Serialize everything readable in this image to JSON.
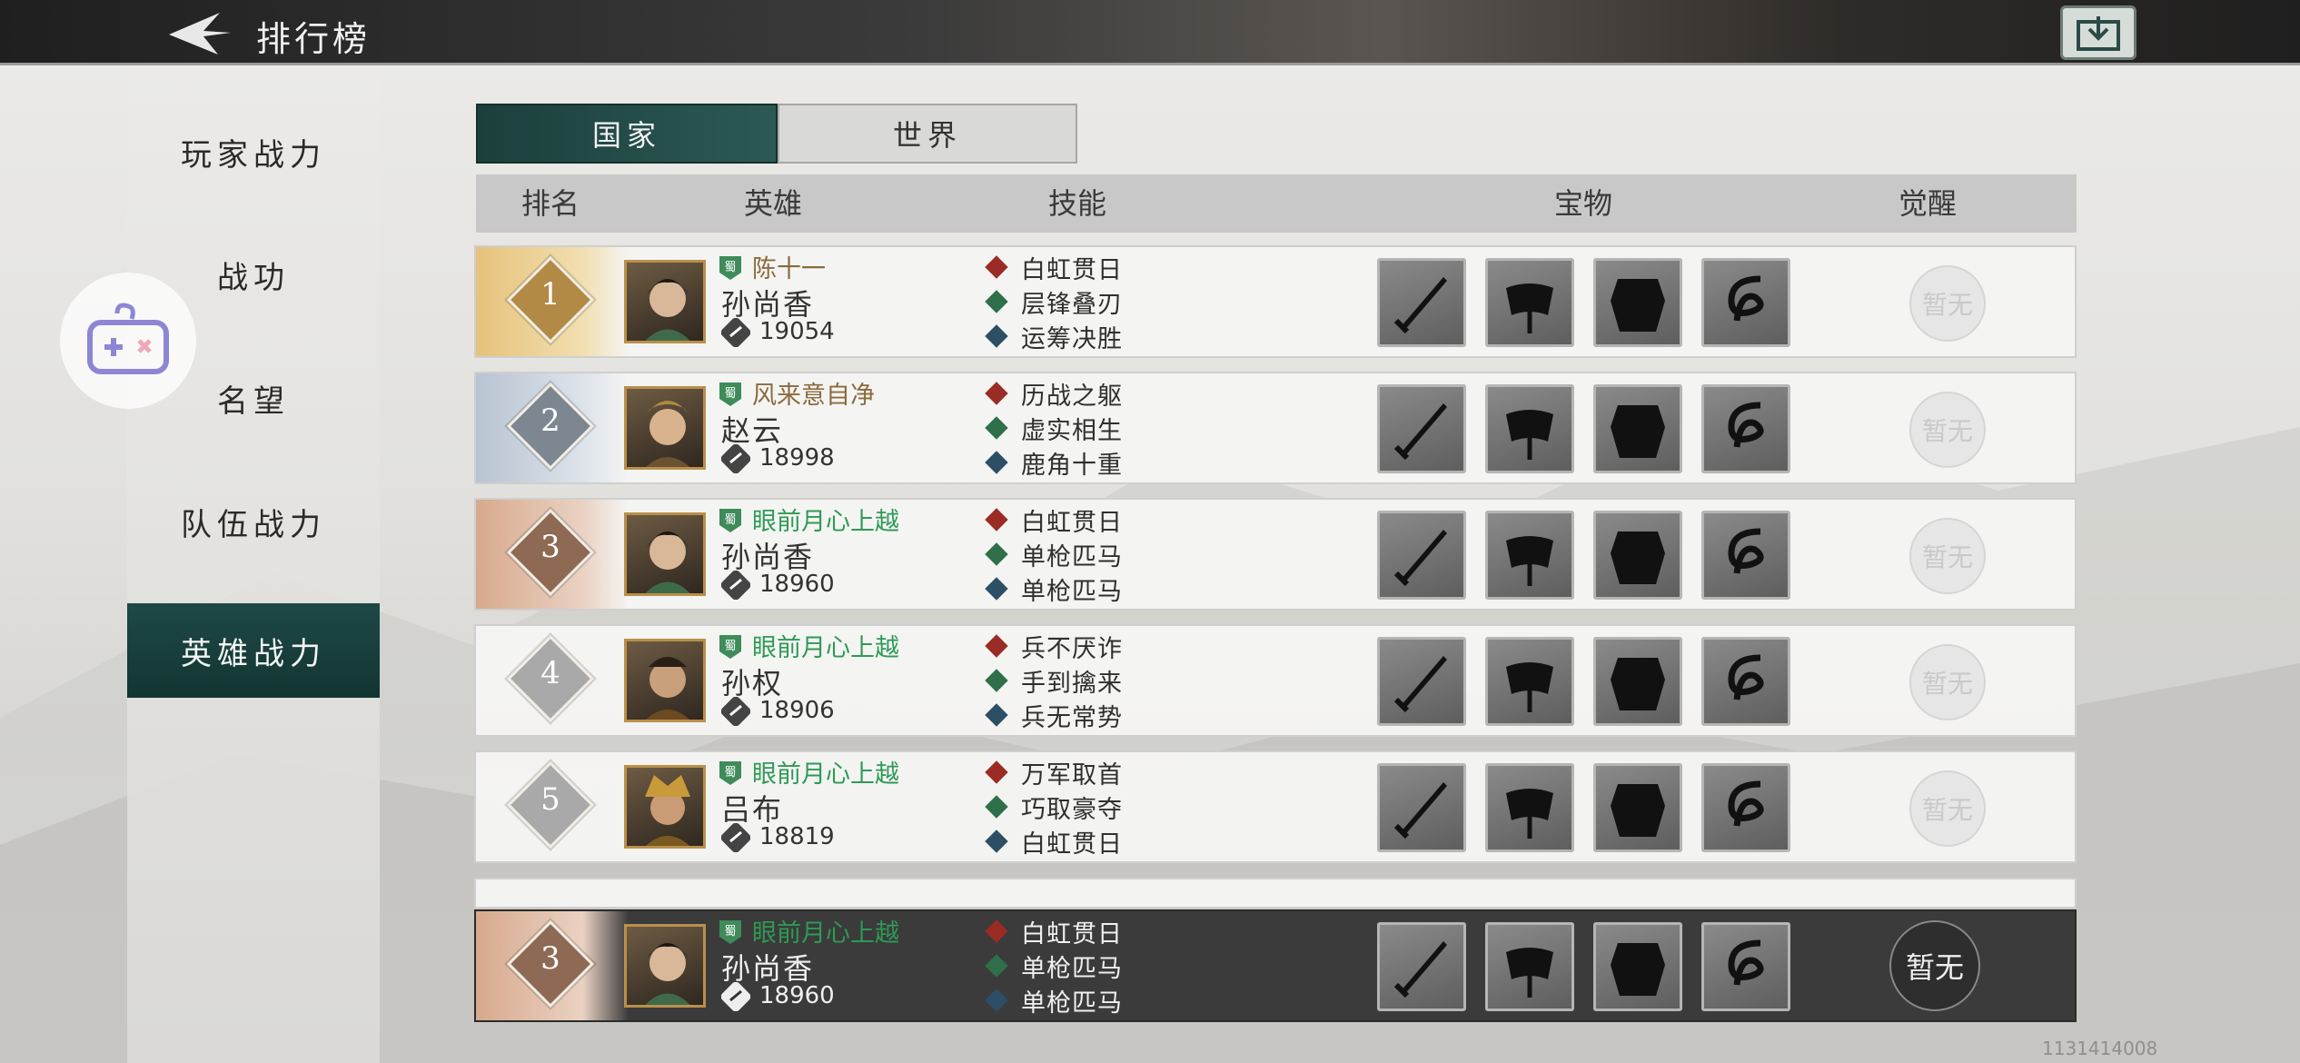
{
  "header": {
    "title": "排行榜",
    "back_icon": "back-arrow-icon",
    "right_icon": "share-export-icon"
  },
  "sidebar": {
    "items": [
      {
        "label": "玩家战力",
        "active": false
      },
      {
        "label": "战功",
        "active": false
      },
      {
        "label": "名望",
        "active": false
      },
      {
        "label": "队伍战力",
        "active": false
      },
      {
        "label": "英雄战力",
        "active": true
      }
    ]
  },
  "tabs": [
    {
      "label": "国家",
      "active": true
    },
    {
      "label": "世界",
      "active": false
    }
  ],
  "columns": {
    "rank": "排名",
    "hero": "英雄",
    "skill": "技能",
    "treasure": "宝物",
    "awaken": "觉醒"
  },
  "faction_label": "蜀",
  "rows": [
    {
      "rank": "1",
      "player": "陈十一",
      "player_color": "#8b6b3d",
      "hero": "孙尚香",
      "power": "19054",
      "skills": [
        "白虹贯日",
        "层锋叠刃",
        "运筹决胜"
      ],
      "awaken": "暂无"
    },
    {
      "rank": "2",
      "player": "风来意自净",
      "player_color": "#8b6b3d",
      "hero": "赵云",
      "power": "18998",
      "skills": [
        "历战之躯",
        "虚实相生",
        "鹿角十重"
      ],
      "awaken": "暂无"
    },
    {
      "rank": "3",
      "player": "眼前月心上越",
      "player_color": "#2e9a55",
      "hero": "孙尚香",
      "power": "18960",
      "skills": [
        "白虹贯日",
        "单枪匹马",
        "单枪匹马"
      ],
      "awaken": "暂无"
    },
    {
      "rank": "4",
      "player": "眼前月心上越",
      "player_color": "#2e9a55",
      "hero": "孙权",
      "power": "18906",
      "skills": [
        "兵不厌诈",
        "手到擒来",
        "兵无常势"
      ],
      "awaken": "暂无"
    },
    {
      "rank": "5",
      "player": "眼前月心上越",
      "player_color": "#2e9a55",
      "hero": "吕布",
      "power": "18819",
      "skills": [
        "万军取首",
        "巧取豪夺",
        "白虹贯日"
      ],
      "awaken": "暂无"
    }
  ],
  "my_row": {
    "rank": "3",
    "player": "眼前月心上越",
    "hero": "孙尚香",
    "power": "18960",
    "skills": [
      "白虹贯日",
      "单枪匹马",
      "单枪匹马"
    ],
    "awaken": "暂无"
  },
  "footer_id": "1131414008",
  "colors": {
    "accent": "#1e4946",
    "gold": "#d9b45a",
    "silver": "#b9c3cc",
    "bronze": "#c9987a",
    "grey": "#bdbdbd"
  }
}
